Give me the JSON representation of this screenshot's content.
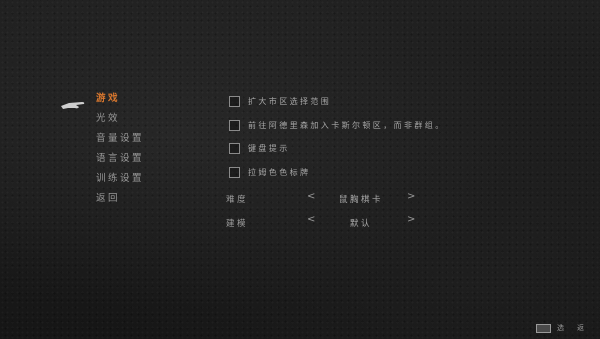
{
  "sidebar": {
    "items": [
      {
        "label": "游戏",
        "active": true
      },
      {
        "label": "光效",
        "active": false
      },
      {
        "label": "音量设置",
        "active": false
      },
      {
        "label": "语言设置",
        "active": false
      },
      {
        "label": "训练设置",
        "active": false
      },
      {
        "label": "返回",
        "active": false
      }
    ],
    "pointer_icon": "hand-pointer-icon"
  },
  "options": {
    "checkboxes": [
      {
        "label": "扩大市区选择范围",
        "checked": false
      },
      {
        "label": "前往阿德里森加入卡斯尔顿区，而非群组。",
        "checked": false
      },
      {
        "label": "键盘提示",
        "checked": false
      },
      {
        "label": "拉姆色色标牌",
        "checked": false
      }
    ],
    "selectors": [
      {
        "label": "难度",
        "value": "鼠胸棋卡",
        "prev": "<",
        "next": ">"
      },
      {
        "label": "建模",
        "value": "默认",
        "prev": "<",
        "next": ">"
      }
    ]
  },
  "footer": {
    "key_hint": "",
    "action_label": "选",
    "extra_label": "返"
  },
  "colors": {
    "accent": "#d8772e",
    "text": "#a7a7a7",
    "background": "#1b1b1b"
  }
}
